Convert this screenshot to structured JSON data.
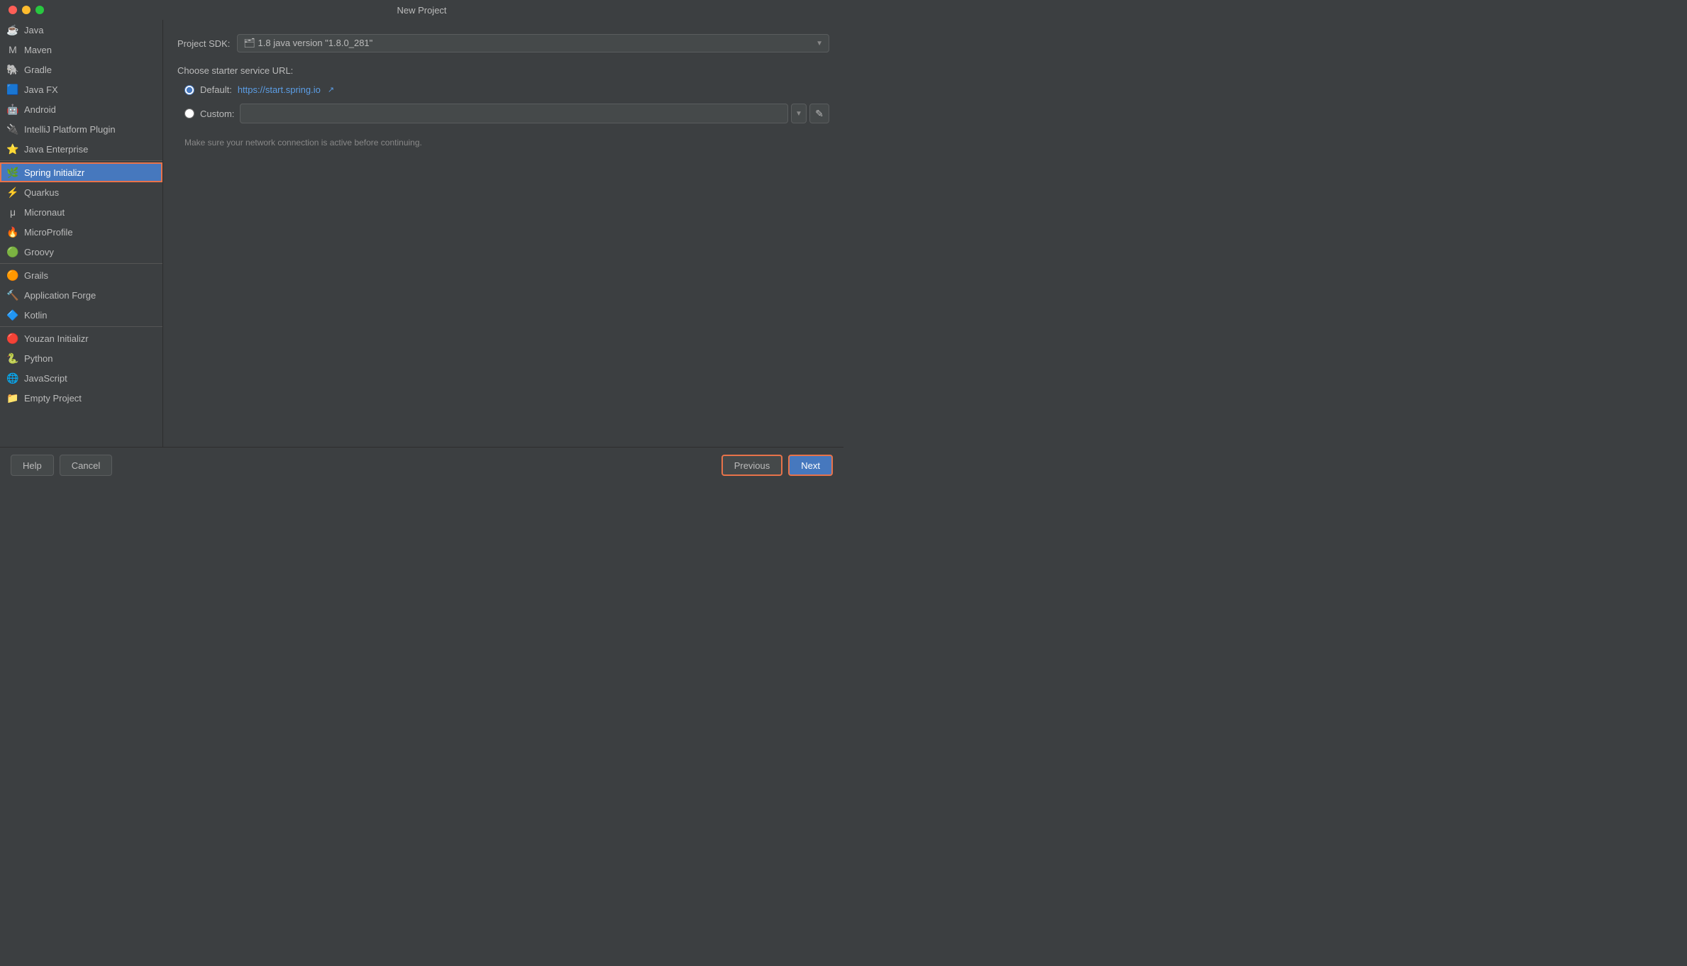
{
  "window": {
    "title": "New Project"
  },
  "sidebar": {
    "items": [
      {
        "id": "java",
        "label": "Java",
        "icon": "☕",
        "selected": false
      },
      {
        "id": "maven",
        "label": "Maven",
        "icon": "M",
        "selected": false
      },
      {
        "id": "gradle",
        "label": "Gradle",
        "icon": "🐘",
        "selected": false
      },
      {
        "id": "javafx",
        "label": "Java FX",
        "icon": "🟦",
        "selected": false
      },
      {
        "id": "android",
        "label": "Android",
        "icon": "🤖",
        "selected": false
      },
      {
        "id": "intellij-plugin",
        "label": "IntelliJ Platform Plugin",
        "icon": "🔌",
        "selected": false
      },
      {
        "id": "java-enterprise",
        "label": "Java Enterprise",
        "icon": "⭐",
        "selected": false
      },
      {
        "id": "spring-initializr",
        "label": "Spring Initializr",
        "icon": "🌿",
        "selected": true
      },
      {
        "id": "quarkus",
        "label": "Quarkus",
        "icon": "⚡",
        "selected": false
      },
      {
        "id": "micronaut",
        "label": "Micronaut",
        "icon": "μ",
        "selected": false
      },
      {
        "id": "microprofile",
        "label": "MicroProfile",
        "icon": "🔥",
        "selected": false
      },
      {
        "id": "groovy",
        "label": "Groovy",
        "icon": "🟢",
        "selected": false
      },
      {
        "id": "grails",
        "label": "Grails",
        "icon": "🟠",
        "selected": false
      },
      {
        "id": "application-forge",
        "label": "Application Forge",
        "icon": "🔨",
        "selected": false
      },
      {
        "id": "kotlin",
        "label": "Kotlin",
        "icon": "🔷",
        "selected": false
      },
      {
        "id": "youzan-initializr",
        "label": "Youzan Initializr",
        "icon": "🔴",
        "selected": false
      },
      {
        "id": "python",
        "label": "Python",
        "icon": "🐍",
        "selected": false
      },
      {
        "id": "javascript",
        "label": "JavaScript",
        "icon": "🌐",
        "selected": false
      },
      {
        "id": "empty-project",
        "label": "Empty Project",
        "icon": "📁",
        "selected": false
      }
    ]
  },
  "content": {
    "sdk_label": "Project SDK:",
    "sdk_value": "🗂 1.8  java version \"1.8.0_281\"",
    "starter_url_label": "Choose starter service URL:",
    "default_label": "Default:",
    "default_url": "https://start.spring.io",
    "custom_label": "Custom:",
    "custom_placeholder": "",
    "hint_text": "Make sure your network connection is active before continuing."
  },
  "buttons": {
    "help": "Help",
    "cancel": "Cancel",
    "previous": "Previous",
    "next": "Next"
  },
  "colors": {
    "selected_bg": "#4678be",
    "highlight_border": "#e8734a",
    "link_color": "#5c9ee6",
    "btn_primary_bg": "#4678be"
  }
}
